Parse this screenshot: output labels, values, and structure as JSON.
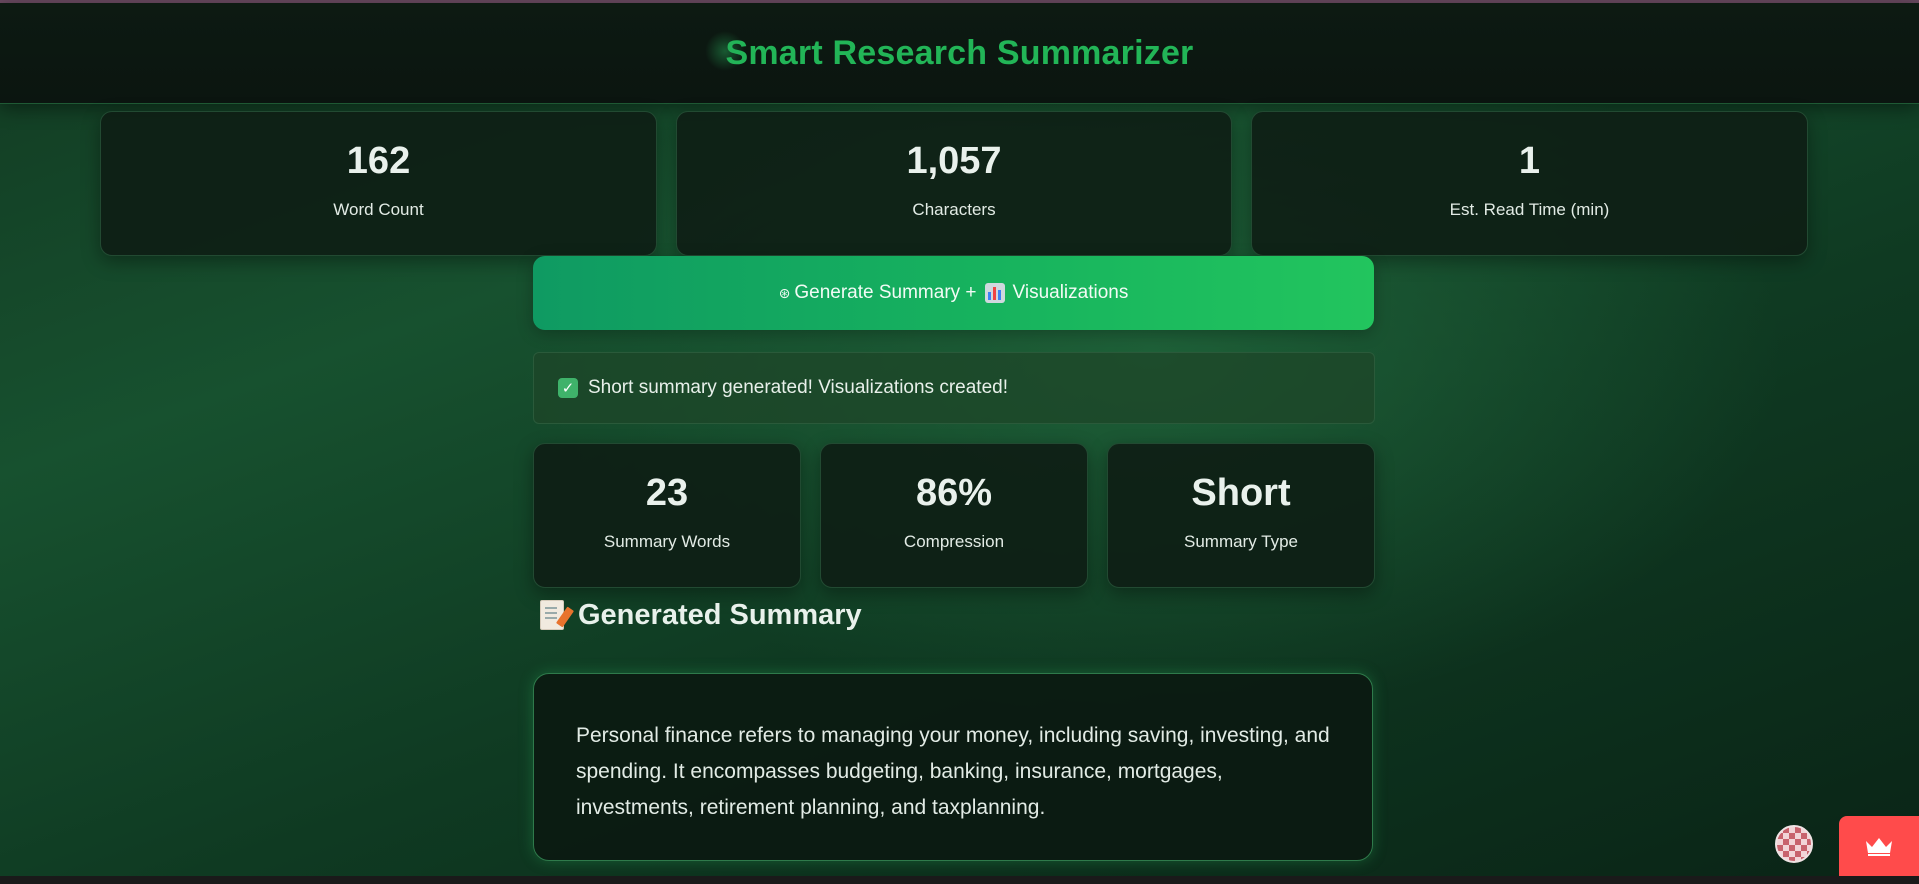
{
  "header": {
    "title": "Smart Research Summarizer"
  },
  "stats": [
    {
      "value": "162",
      "label": "Word Count"
    },
    {
      "value": "1,057",
      "label": "Characters"
    },
    {
      "value": "1",
      "label": "Est. Read Time (min)"
    }
  ],
  "generate_button": {
    "label_part1": "Generate Summary +",
    "label_part2": "Visualizations"
  },
  "success_message": "Short summary generated! Visualizations created!",
  "summary_stats": [
    {
      "value": "23",
      "label": "Summary Words"
    },
    {
      "value": "86%",
      "label": "Compression"
    },
    {
      "value": "Short",
      "label": "Summary Type"
    }
  ],
  "generated_summary": {
    "heading": "Generated Summary",
    "text": "Personal finance refers to managing your money, including saving, investing, and spending. It encompasses budgeting, banking, insurance, mortgages, investments, retirement planning, and taxplanning."
  },
  "colors": {
    "accent": "#22b557",
    "button_start": "#0f9a62",
    "button_end": "#22c55e",
    "deploy": "#ff4b4b"
  }
}
